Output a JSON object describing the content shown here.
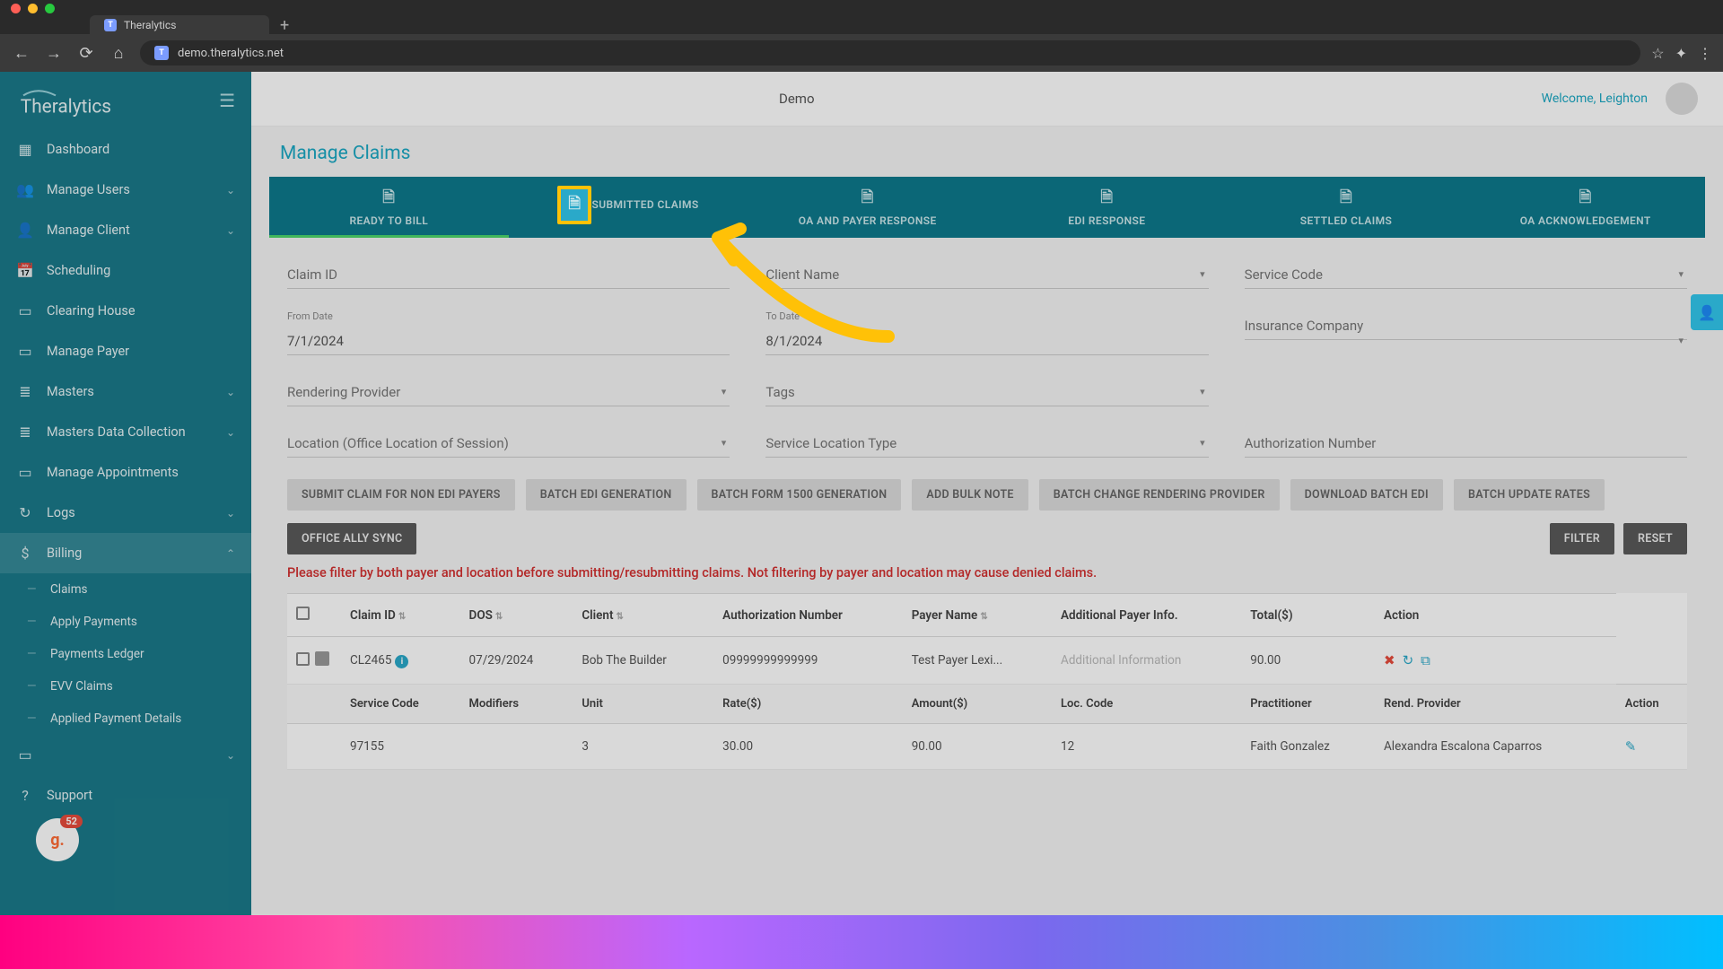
{
  "browser": {
    "tab_title": "Theralytics",
    "url": "demo.theralytics.net"
  },
  "sidebar": {
    "logo_text": "Theralytics",
    "items": [
      {
        "icon": "⊞",
        "label": "Dashboard",
        "chevron": false
      },
      {
        "icon": "👥",
        "label": "Manage Users",
        "chevron": true
      },
      {
        "icon": "👤",
        "label": "Manage Client",
        "chevron": true
      },
      {
        "icon": "📅",
        "label": "Scheduling",
        "chevron": false
      },
      {
        "icon": "💳",
        "label": "Clearing House",
        "chevron": false
      },
      {
        "icon": "💳",
        "label": "Manage Payer",
        "chevron": false
      },
      {
        "icon": "≡",
        "label": "Masters",
        "chevron": true
      },
      {
        "icon": "≡",
        "label": "Masters Data Collection",
        "chevron": true
      },
      {
        "icon": "📋",
        "label": "Manage Appointments",
        "chevron": false
      },
      {
        "icon": "↻",
        "label": "Logs",
        "chevron": true
      },
      {
        "icon": "$",
        "label": "Billing",
        "chevron": true,
        "expanded": true
      },
      {
        "icon": "📋",
        "label": "",
        "chevron": true
      },
      {
        "icon": "?",
        "label": "Support",
        "chevron": false
      }
    ],
    "billing_sub": [
      "Claims",
      "Apply Payments",
      "Payments Ledger",
      "EVV Claims",
      "Applied Payment Details"
    ],
    "badge_letter": "g.",
    "badge_count": "52"
  },
  "header": {
    "org": "Demo",
    "welcome": "Welcome, Leighton"
  },
  "page": {
    "title": "Manage Claims"
  },
  "tabs": [
    "READY TO BILL",
    "SUBMITTED CLAIMS",
    "OA AND PAYER RESPONSE",
    "EDI RESPONSE",
    "SETTLED CLAIMS",
    "OA ACKNOWLEDGEMENT"
  ],
  "filters": {
    "claim_id": {
      "label": "Claim ID",
      "value": ""
    },
    "client_name": {
      "label": "Client Name",
      "value": ""
    },
    "service_code": {
      "label": "Service Code",
      "value": ""
    },
    "from_date": {
      "label": "From Date",
      "value": "7/1/2024"
    },
    "to_date": {
      "label": "To Date",
      "value": "8/1/2024"
    },
    "insurance": {
      "label": "Insurance Company",
      "value": ""
    },
    "rendering": {
      "label": "Rendering Provider",
      "value": ""
    },
    "tags": {
      "label": "Tags",
      "value": ""
    },
    "location": {
      "label": "Location (Office Location of Session)",
      "value": ""
    },
    "service_loc": {
      "label": "Service Location Type",
      "value": ""
    },
    "auth": {
      "label": "Authorization Number",
      "value": ""
    }
  },
  "buttons": {
    "submit_non_edi": "SUBMIT CLAIM FOR NON EDI PAYERS",
    "batch_edi": "BATCH EDI GENERATION",
    "batch_1500": "BATCH FORM 1500 GENERATION",
    "bulk_note": "ADD BULK NOTE",
    "batch_render": "BATCH CHANGE RENDERING PROVIDER",
    "download_edi": "DOWNLOAD BATCH EDI",
    "batch_rates": "BATCH UPDATE RATES",
    "office_ally": "OFFICE ALLY SYNC",
    "filter": "FILTER",
    "reset": "RESET"
  },
  "warning": "Please filter by both payer and location before submitting/resubmitting claims. Not filtering by payer and location may cause denied claims.",
  "table": {
    "headers": [
      "",
      "Claim ID",
      "DOS",
      "Client",
      "Authorization Number",
      "Payer Name",
      "Additional Payer Info.",
      "Total($)",
      "Action"
    ],
    "row": {
      "claim_id": "CL2465",
      "dos": "07/29/2024",
      "client": "Bob The Builder",
      "auth": "09999999999999",
      "payer": "Test Payer Lexi...",
      "addl": "Additional Information",
      "total": "90.00"
    },
    "sub_headers": [
      "Service Code",
      "Modifiers",
      "Unit",
      "Rate($)",
      "Amount($)",
      "Loc. Code",
      "Practitioner",
      "Rend. Provider",
      "Action"
    ],
    "sub_row": {
      "service_code": "97155",
      "modifiers": "",
      "unit": "3",
      "rate": "30.00",
      "amount": "90.00",
      "loc": "12",
      "practitioner": "Faith Gonzalez",
      "rend": "Alexandra Escalona Caparros"
    }
  }
}
